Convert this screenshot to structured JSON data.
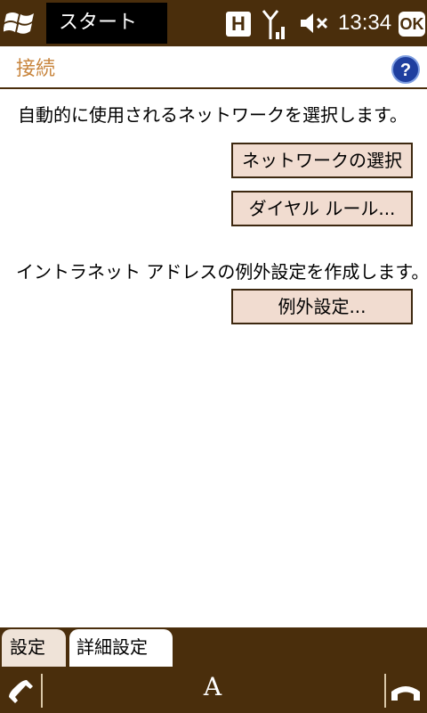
{
  "status_bar": {
    "start_label": "スタート",
    "network_badge": "H",
    "time": "13:34",
    "ok_label": "OK"
  },
  "header": {
    "title": "接続"
  },
  "content": {
    "network_description": "自動的に使用されるネットワークを選択します。",
    "select_network_button": "ネットワークの選択",
    "dialing_rules_button": "ダイヤル ルール...",
    "exceptions_description": "イントラネット アドレスの例外設定を作成します。",
    "exceptions_button": "例外設定..."
  },
  "tabs": [
    {
      "label": "設定",
      "active": false
    },
    {
      "label": "詳細設定",
      "active": true
    }
  ],
  "bottom_bar": {
    "input_glyph": "A"
  },
  "colors": {
    "chrome": "#4a2e0c",
    "title_accent": "#c8853d",
    "button_face": "#f1dcd0",
    "help_blue": "#1f3f9f"
  }
}
